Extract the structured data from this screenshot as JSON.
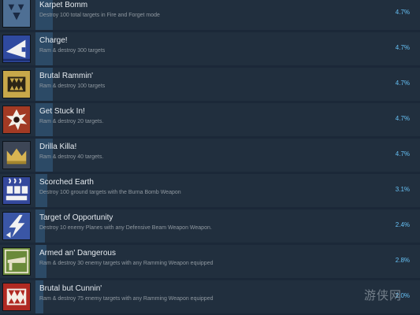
{
  "achievements": [
    {
      "title": "Karpet Bomm",
      "description": "Destroy 100 total targets in Fire and Forget mode",
      "percent": "4.7%",
      "progress_pct": 4.7,
      "icon": "bombs-triangle-icon",
      "colors": {
        "bg": "#4e6f94",
        "fg": "#1a2a44"
      }
    },
    {
      "title": "Charge!",
      "description": "Ram & destroy 300 targets",
      "percent": "4.7%",
      "progress_pct": 4.7,
      "icon": "ram-charge-icon",
      "colors": {
        "bg": "#2f4aa0",
        "fg": "#f2f2f2"
      }
    },
    {
      "title": "Brutal Rammin'",
      "description": "Ram & destroy 100 targets",
      "percent": "4.7%",
      "progress_pct": 4.7,
      "icon": "ram-jaw-icon",
      "colors": {
        "bg": "#c8a84a",
        "fg": "#2b2416"
      }
    },
    {
      "title": "Get Stuck In!",
      "description": "Ram & destroy 20 targets.",
      "percent": "4.7%",
      "progress_pct": 4.7,
      "icon": "spiked-ram-icon",
      "colors": {
        "bg": "#a23a24",
        "fg": "#f2efe8"
      }
    },
    {
      "title": "Drilla Killa!",
      "description": "Ram & destroy 40 targets.",
      "percent": "4.7%",
      "progress_pct": 4.7,
      "icon": "drill-crown-icon",
      "colors": {
        "bg": "#3d4656",
        "fg": "#d8b452"
      }
    },
    {
      "title": "Scorched Earth",
      "description": "Destroy 100 ground targets with the Burna Bomb Weapon",
      "percent": "3.1%",
      "progress_pct": 3.1,
      "icon": "burna-bomb-icon",
      "colors": {
        "bg": "#34489c",
        "fg": "#f2f2f2"
      }
    },
    {
      "title": "Target of Opportunity",
      "description": "Destroy 10 enemy Planes with any Defensive Beam Weapon Weapon.",
      "percent": "2.4%",
      "progress_pct": 2.4,
      "icon": "lightning-target-icon",
      "colors": {
        "bg": "#3a56a6",
        "fg": "#f2f2f2"
      }
    },
    {
      "title": "Armed an' Dangerous",
      "description": "Ram & destroy 30 enemy targets with any Ramming Weapon equipped",
      "percent": "2.8%",
      "progress_pct": 2.8,
      "icon": "armed-blade-icon",
      "colors": {
        "bg": "#6a8a3a",
        "fg": "#e6e2c8"
      }
    },
    {
      "title": "Brutal but Cunnin'",
      "description": "Ram & destroy 75 enemy targets with any Ramming Weapon equipped",
      "percent": "2.0%",
      "progress_pct": 2.0,
      "icon": "fanged-jaw-icon",
      "colors": {
        "bg": "#b02a22",
        "fg": "#f4efe6"
      }
    }
  ],
  "watermark": "游侠网"
}
